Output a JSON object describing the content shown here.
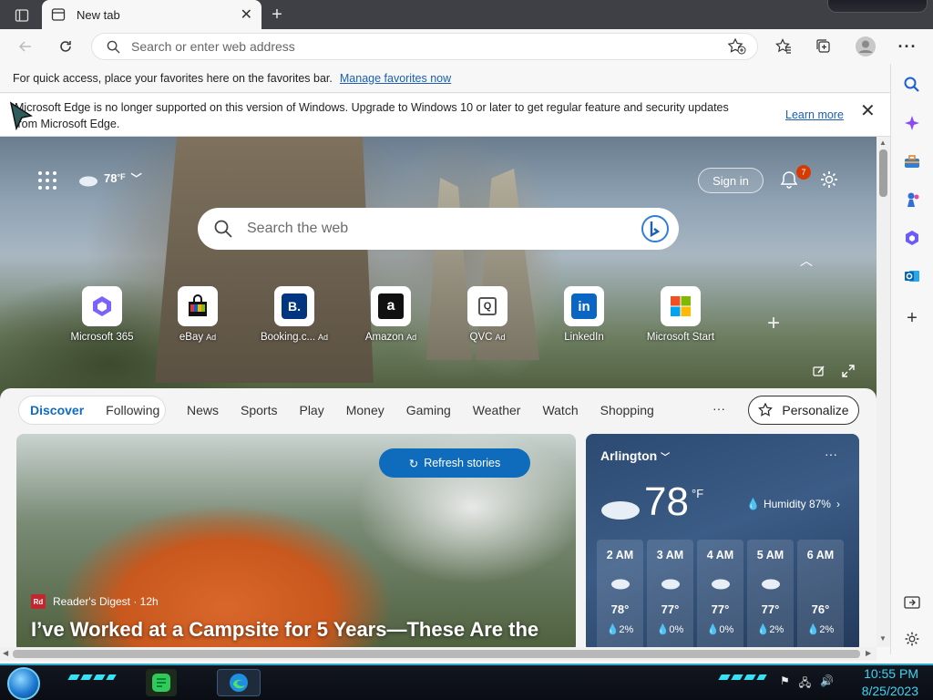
{
  "browser": {
    "tab_title": "New tab",
    "address_placeholder": "Search or enter web address"
  },
  "favorites_bar": {
    "text": "For quick access, place your favorites here on the favorites bar.",
    "link": "Manage favorites now"
  },
  "info_bar": {
    "line1": "Microsoft Edge is no longer supported on this version of Windows. Upgrade to Windows 10 or later to get regular feature and security updates",
    "line2": "from Microsoft Edge.",
    "learn_more": "Learn more"
  },
  "hero": {
    "weather_temp": "78",
    "weather_unit": "°F",
    "sign_in": "Sign in",
    "notifications": "7",
    "search_placeholder": "Search the web"
  },
  "quick_links": [
    {
      "label": "Microsoft 365",
      "ad": ""
    },
    {
      "label": "eBay",
      "ad": "Ad"
    },
    {
      "label": "Booking.c...",
      "ad": "Ad"
    },
    {
      "label": "Amazon",
      "ad": "Ad"
    },
    {
      "label": "QVC",
      "ad": "Ad"
    },
    {
      "label": "LinkedIn",
      "ad": ""
    },
    {
      "label": "Microsoft Start",
      "ad": ""
    }
  ],
  "feed_nav": {
    "discover": "Discover",
    "following": "Following",
    "items": [
      "News",
      "Sports",
      "Play",
      "Money",
      "Gaming",
      "Weather",
      "Watch",
      "Shopping"
    ],
    "more": "···",
    "personalize": "Personalize"
  },
  "story": {
    "refresh": "Refresh stories",
    "source_logo": "Rd",
    "source": "Reader's Digest · 12h",
    "headline": "I’ve Worked at a Campsite for 5 Years—These Are the"
  },
  "weather_card": {
    "city": "Arlington",
    "temp": "78",
    "unit": "°F",
    "humidity": "Humidity 87%",
    "hours": [
      {
        "time": "2 AM",
        "temp": "78°",
        "precip": "2%"
      },
      {
        "time": "3 AM",
        "temp": "77°",
        "precip": "0%"
      },
      {
        "time": "4 AM",
        "temp": "77°",
        "precip": "0%"
      },
      {
        "time": "5 AM",
        "temp": "77°",
        "precip": "2%"
      },
      {
        "time": "6 AM",
        "temp": "76°",
        "precip": "2%"
      }
    ]
  },
  "taskbar": {
    "time": "10:55 PM",
    "date": "8/25/2023"
  }
}
